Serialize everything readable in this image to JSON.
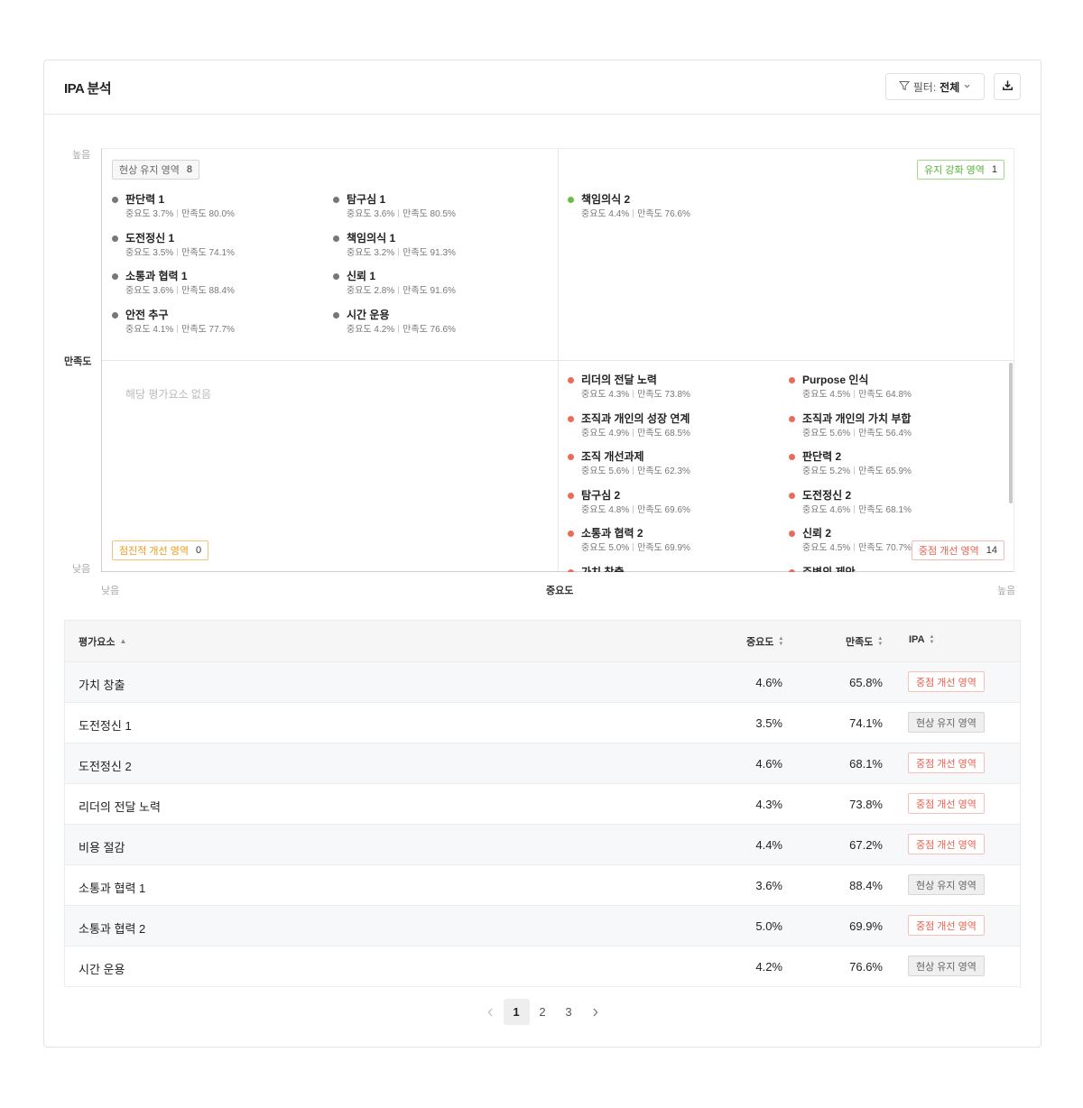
{
  "header": {
    "title": "IPA 분석",
    "filter_prefix": "필터:",
    "filter_value": "전체"
  },
  "chart": {
    "y_high": "높음",
    "y_low": "낮음",
    "y_title": "만족도",
    "x_low": "낮음",
    "x_high": "높음",
    "x_title": "중요도",
    "imp_prefix": "중요도",
    "sat_prefix": "만족도",
    "empty_message": "해당 평가요소 없음",
    "quadrants": {
      "maintain": {
        "label": "현상 유지 영역",
        "count": "8"
      },
      "reinforce": {
        "label": "유지 강화 영역",
        "count": "1"
      },
      "gradual": {
        "label": "점진적 개선 영역",
        "count": "0"
      },
      "focus": {
        "label": "중점 개선 영역",
        "count": "14"
      }
    },
    "maintain_items": [
      {
        "name": "판단력 1",
        "imp": "3.7%",
        "sat": "80.0%"
      },
      {
        "name": "탐구심 1",
        "imp": "3.6%",
        "sat": "80.5%"
      },
      {
        "name": "도전정신 1",
        "imp": "3.5%",
        "sat": "74.1%"
      },
      {
        "name": "책임의식 1",
        "imp": "3.2%",
        "sat": "91.3%"
      },
      {
        "name": "소통과 협력 1",
        "imp": "3.6%",
        "sat": "88.4%"
      },
      {
        "name": "신뢰 1",
        "imp": "2.8%",
        "sat": "91.6%"
      },
      {
        "name": "안전 추구",
        "imp": "4.1%",
        "sat": "77.7%"
      },
      {
        "name": "시간 운용",
        "imp": "4.2%",
        "sat": "76.6%"
      }
    ],
    "reinforce_items": [
      {
        "name": "책임의식 2",
        "imp": "4.4%",
        "sat": "76.6%"
      }
    ],
    "focus_items": [
      {
        "name": "리더의 전달 노력",
        "imp": "4.3%",
        "sat": "73.8%"
      },
      {
        "name": "Purpose 인식",
        "imp": "4.5%",
        "sat": "64.8%"
      },
      {
        "name": "조직과 개인의 성장 연계",
        "imp": "4.9%",
        "sat": "68.5%"
      },
      {
        "name": "조직과 개인의 가치 부합",
        "imp": "5.6%",
        "sat": "56.4%"
      },
      {
        "name": "조직 개선과제",
        "imp": "5.6%",
        "sat": "62.3%"
      },
      {
        "name": "판단력 2",
        "imp": "5.2%",
        "sat": "65.9%"
      },
      {
        "name": "탐구심 2",
        "imp": "4.8%",
        "sat": "69.6%"
      },
      {
        "name": "도전정신 2",
        "imp": "4.6%",
        "sat": "68.1%"
      },
      {
        "name": "소통과 협력 2",
        "imp": "5.0%",
        "sat": "69.9%"
      },
      {
        "name": "신뢰 2",
        "imp": "4.5%",
        "sat": "70.7%"
      },
      {
        "name": "가치 창출",
        "imp": "",
        "sat": ""
      },
      {
        "name": "주변의 제안",
        "imp": "",
        "sat": ""
      }
    ]
  },
  "table": {
    "headers": {
      "name": "평가요소",
      "imp": "중요도",
      "sat": "만족도",
      "ipa": "IPA"
    },
    "rows": [
      {
        "name": "가치 창출",
        "imp": "4.6%",
        "sat": "65.8%",
        "ipa": "중점 개선 영역",
        "kind": "red"
      },
      {
        "name": "도전정신 1",
        "imp": "3.5%",
        "sat": "74.1%",
        "ipa": "현상 유지 영역",
        "kind": "gray"
      },
      {
        "name": "도전정신 2",
        "imp": "4.6%",
        "sat": "68.1%",
        "ipa": "중점 개선 영역",
        "kind": "red"
      },
      {
        "name": "리더의 전달 노력",
        "imp": "4.3%",
        "sat": "73.8%",
        "ipa": "중점 개선 영역",
        "kind": "red"
      },
      {
        "name": "비용 절감",
        "imp": "4.4%",
        "sat": "67.2%",
        "ipa": "중점 개선 영역",
        "kind": "red"
      },
      {
        "name": "소통과 협력 1",
        "imp": "3.6%",
        "sat": "88.4%",
        "ipa": "현상 유지 영역",
        "kind": "gray"
      },
      {
        "name": "소통과 협력 2",
        "imp": "5.0%",
        "sat": "69.9%",
        "ipa": "중점 개선 영역",
        "kind": "red"
      },
      {
        "name": "시간 운용",
        "imp": "4.2%",
        "sat": "76.6%",
        "ipa": "현상 유지 영역",
        "kind": "gray"
      }
    ]
  },
  "pagination": {
    "pages": [
      "1",
      "2",
      "3"
    ],
    "current": "1"
  },
  "colors": {
    "red": "#e8604c",
    "green": "#52b43a",
    "orange": "#ef9a1a",
    "gray": "#666666"
  }
}
